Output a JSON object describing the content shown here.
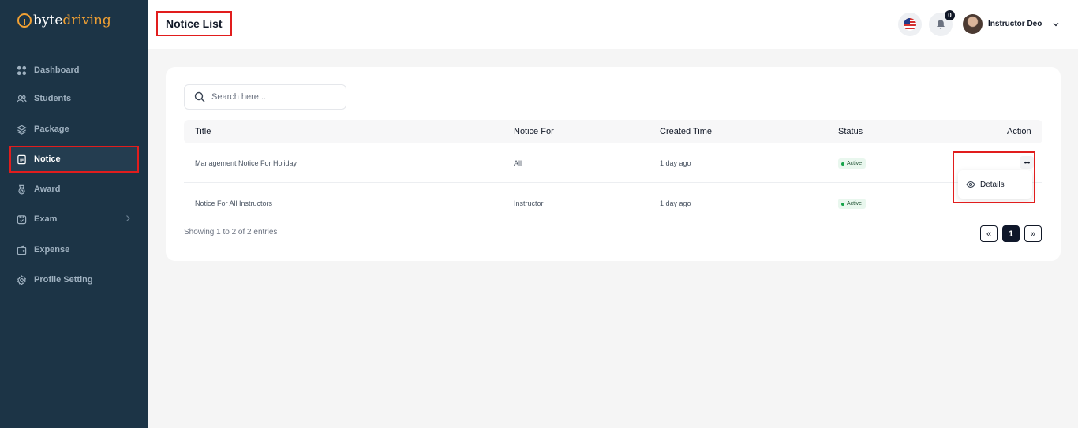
{
  "brand": {
    "part1": "byte",
    "part2": "driving"
  },
  "sidebar": {
    "items": [
      {
        "label": "Dashboard",
        "icon": "dashboard-icon"
      },
      {
        "label": "Students",
        "icon": "users-icon"
      },
      {
        "label": "Package",
        "icon": "layers-icon"
      },
      {
        "label": "Notice",
        "icon": "notice-icon",
        "active": true
      },
      {
        "label": "Award",
        "icon": "award-icon"
      },
      {
        "label": "Exam",
        "icon": "exam-icon"
      },
      {
        "label": "Expense",
        "icon": "wallet-icon"
      },
      {
        "label": "Profile Setting",
        "icon": "gear-icon"
      }
    ]
  },
  "header": {
    "title": "Notice List",
    "notification_count": "0",
    "user_name": "Instructor Deo"
  },
  "search": {
    "placeholder": "Search here..."
  },
  "table": {
    "columns": [
      "Title",
      "Notice For",
      "Created Time",
      "Status",
      "Action"
    ],
    "rows": [
      {
        "title": "Management Notice For Holiday",
        "notice_for": "All",
        "created": "1 day ago",
        "status": "Active"
      },
      {
        "title": "Notice For All Instructors",
        "notice_for": "Instructor",
        "created": "1 day ago",
        "status": "Active"
      }
    ]
  },
  "action_menu": {
    "details_label": "Details"
  },
  "footer": {
    "info": "Showing 1 to 2 of 2 entries"
  },
  "pagination": {
    "prev": "«",
    "current": "1",
    "next": "»"
  },
  "colors": {
    "sidebar_bg": "#1c3446",
    "brand_accent": "#f0a033",
    "highlight": "#e11d1d",
    "status_active": "#16a34a"
  }
}
